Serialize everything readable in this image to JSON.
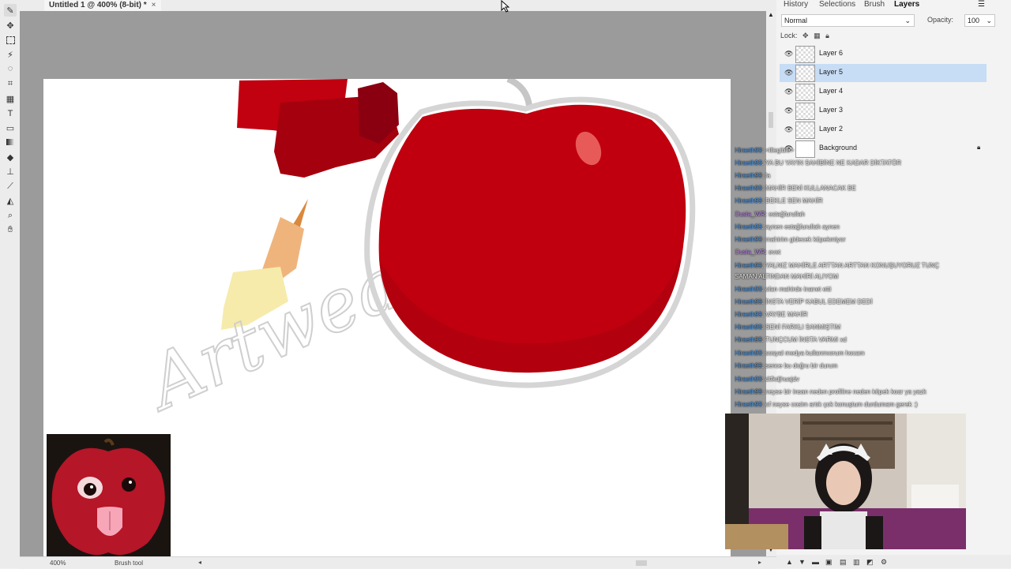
{
  "document": {
    "tab_title": "Untitled 1 @ 400% (8-bit) *",
    "close_glyph": "×"
  },
  "toolbar": {
    "tools": [
      "brush-tool",
      "move-tool",
      "marquee-tool",
      "magic-wand-tool",
      "lasso-tool",
      "crop-tool",
      "grid-tool",
      "type-tool",
      "shape-tool",
      "gradient-tool",
      "eraser-tool",
      "stamp-tool",
      "eyedropper-tool",
      "fill-tool",
      "zoom-tool",
      "hand-tool"
    ]
  },
  "panel": {
    "tabs": [
      "History",
      "Selections",
      "Brush",
      "Layers"
    ],
    "active_tab": "Layers",
    "blend_mode": "Normal",
    "opacity_label": "Opacity:",
    "opacity_value": "100",
    "lock_label": "Lock:",
    "layers": [
      {
        "name": "Layer 6",
        "selected": false
      },
      {
        "name": "Layer 5",
        "selected": true
      },
      {
        "name": "Layer 4",
        "selected": false
      },
      {
        "name": "Layer 3",
        "selected": false
      },
      {
        "name": "Layer 2",
        "selected": false
      },
      {
        "name": "Background",
        "selected": false,
        "locked": true
      }
    ]
  },
  "status": {
    "zoom": "400%",
    "tool": "Brush tool"
  },
  "canvas": {
    "watermark": "Artweaver"
  },
  "chat": [
    {
      "user": "Hiraeth99",
      "text": ": <illegible>"
    },
    {
      "user": "Hiraeth99",
      "text": ": YA BU YAYIN SAHİBİNE NE KADAR DİKTATÖR"
    },
    {
      "user": "Hiraeth99",
      "text": ": la"
    },
    {
      "user": "Hiraeth99",
      "text": ": MAHİR BENİ KULLANACAK BE"
    },
    {
      "user": "Hiraeth99",
      "text": ": BEKLE SEN MAHİR"
    },
    {
      "user": "Ousia_WR",
      "text": ": estağfurullah"
    },
    {
      "user": "Hiraeth99",
      "text": ": aynen estağfurullah aynen"
    },
    {
      "user": "Hiraeth99",
      "text": ": mahirim gidecek küpekmiyor"
    },
    {
      "user": "Ousia_WR",
      "text": ": evet"
    },
    {
      "user": "Hiraeth99",
      "text": ": YALNIZ MAHİRLE ARTTAN ARTTAN KONUŞUYORUZ TUNÇ"
    },
    {
      "user": "",
      "text": "SAMAN ALTINDAN MAHİRİ ALIYOM"
    },
    {
      "user": "Hiraeth99",
      "text": ": olan mahirde inanet etti"
    },
    {
      "user": "Hiraeth99",
      "text": ": İNSTA VERİP KABUL EDEMEM DEDİ"
    },
    {
      "user": "Hiraeth99",
      "text": ": VAYBE MAHİR"
    },
    {
      "user": "Hiraeth99",
      "text": ": SENİ FARKLI SANMIŞTIM"
    },
    {
      "user": "Hiraeth99",
      "text": ": TUNÇCUM İNSTA VARMI xd"
    },
    {
      "user": "Hiraeth99",
      "text": ": sosyal medya kullanmıorum hocam"
    },
    {
      "user": "Hiraeth99",
      "text": ": sence bu doğru bir durum"
    },
    {
      "user": "Hiraeth99",
      "text": ": dtfkdjhuajdv"
    },
    {
      "user": "Hiraeth99",
      "text": ": neyse bir insan neden profiline neden köpek koar ya yazk"
    },
    {
      "user": "Hiraeth99",
      "text": ": of neyse cosim artık çok konuştum durdumam gerek :)"
    }
  ],
  "colors": {
    "accent": "#c7dcf5",
    "apple_red": "#c0000f",
    "workspace": "#9b9b9b",
    "chat_user": "#4ea0f5"
  }
}
